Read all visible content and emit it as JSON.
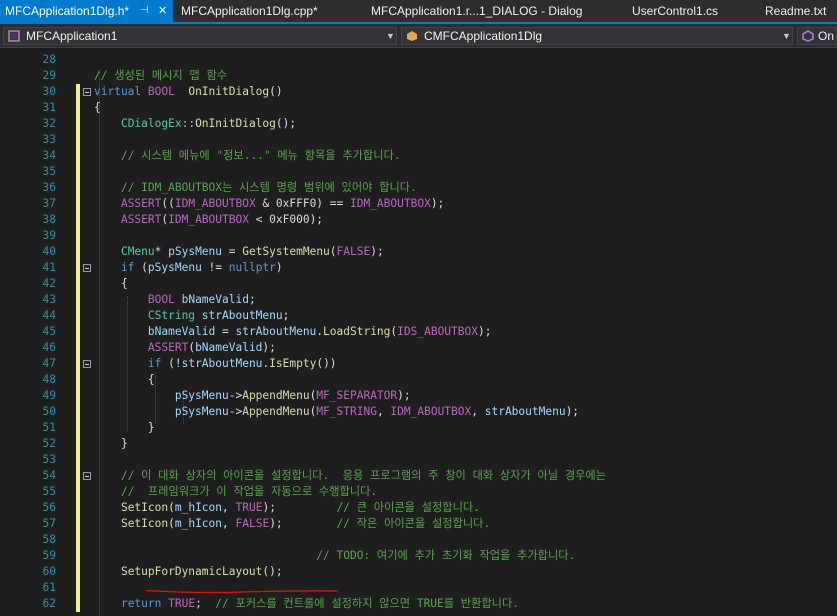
{
  "tabs": [
    {
      "label": "MFCApplication1Dlg.h*",
      "active": true
    },
    {
      "label": "MFCApplication1Dlg.cpp*"
    },
    {
      "label": "MFCApplication1.r...1_DIALOG - Dialog"
    },
    {
      "label": "UserControl1.cs"
    },
    {
      "label": "Readme.txt"
    }
  ],
  "tab_icons": {
    "pin": "pin-icon",
    "close": "close-icon"
  },
  "nav": {
    "project": "MFCApplication1",
    "class": "CMFCApplication1Dlg",
    "member": "On"
  },
  "colors": {
    "accent": "#007acc",
    "line_number": "#2b91af",
    "keyword": "#569cd6",
    "comment": "#57a64a",
    "change_bar": "#eff28e"
  },
  "lines": [
    {
      "n": "28",
      "t": []
    },
    {
      "n": "29",
      "t": [
        [
          "cm",
          "// 생성된 메시지 맵 함수"
        ]
      ]
    },
    {
      "n": "30",
      "t": [
        [
          "kw",
          "virtual "
        ],
        [
          "mac",
          "BOOL"
        ],
        [
          "",
          "  "
        ],
        [
          "fn",
          "OnInitDialog"
        ],
        [
          "",
          "()"
        ]
      ],
      "fold": true
    },
    {
      "n": "31",
      "t": [
        [
          "",
          "{"
        ]
      ]
    },
    {
      "n": "32",
      "t": [
        [
          "",
          "    "
        ],
        [
          "ty",
          "CDialogEx"
        ],
        [
          "op",
          "::"
        ],
        [
          "fn",
          "OnInitDialog"
        ],
        [
          "",
          "();"
        ]
      ]
    },
    {
      "n": "33",
      "t": []
    },
    {
      "n": "34",
      "t": [
        [
          "",
          "    "
        ],
        [
          "cm",
          "// 시스템 메뉴에 \"정보...\" 메뉴 항목을 추가합니다."
        ]
      ]
    },
    {
      "n": "35",
      "t": []
    },
    {
      "n": "36",
      "t": [
        [
          "",
          "    "
        ],
        [
          "cm",
          "// IDM_ABOUTBOX는 시스템 명령 범위에 있어야 합니다."
        ]
      ]
    },
    {
      "n": "37",
      "t": [
        [
          "",
          "    "
        ],
        [
          "mac",
          "ASSERT"
        ],
        [
          "",
          "(("
        ],
        [
          "mac",
          "IDM_ABOUTBOX"
        ],
        [
          "",
          " & 0xFFF0) == "
        ],
        [
          "mac",
          "IDM_ABOUTBOX"
        ],
        [
          "",
          ");"
        ]
      ]
    },
    {
      "n": "38",
      "t": [
        [
          "",
          "    "
        ],
        [
          "mac",
          "ASSERT"
        ],
        [
          "",
          "("
        ],
        [
          "mac",
          "IDM_ABOUTBOX"
        ],
        [
          "",
          " < 0xF000);"
        ]
      ]
    },
    {
      "n": "39",
      "t": []
    },
    {
      "n": "40",
      "t": [
        [
          "",
          "    "
        ],
        [
          "ty",
          "CMenu"
        ],
        [
          "",
          "* "
        ],
        [
          "id",
          "pSysMenu"
        ],
        [
          "",
          " = "
        ],
        [
          "fn",
          "GetSystemMenu"
        ],
        [
          "",
          "("
        ],
        [
          "mac",
          "FALSE"
        ],
        [
          "",
          ");"
        ]
      ]
    },
    {
      "n": "41",
      "t": [
        [
          "",
          "    "
        ],
        [
          "kw",
          "if"
        ],
        [
          "",
          " ("
        ],
        [
          "id",
          "pSysMenu"
        ],
        [
          "",
          " != "
        ],
        [
          "kw",
          "nullptr"
        ],
        [
          "",
          ")"
        ]
      ],
      "fold": true
    },
    {
      "n": "42",
      "t": [
        [
          "",
          "    {"
        ]
      ]
    },
    {
      "n": "43",
      "t": [
        [
          "",
          "        "
        ],
        [
          "mac",
          "BOOL"
        ],
        [
          "",
          " "
        ],
        [
          "id",
          "bNameValid"
        ],
        [
          "",
          ";"
        ]
      ]
    },
    {
      "n": "44",
      "t": [
        [
          "",
          "        "
        ],
        [
          "ty",
          "CString"
        ],
        [
          "",
          " "
        ],
        [
          "id",
          "strAboutMenu"
        ],
        [
          "",
          ";"
        ]
      ]
    },
    {
      "n": "45",
      "t": [
        [
          "",
          "        "
        ],
        [
          "id",
          "bNameValid"
        ],
        [
          "",
          " = "
        ],
        [
          "id",
          "strAboutMenu"
        ],
        [
          "",
          "."
        ],
        [
          "fn",
          "LoadString"
        ],
        [
          "",
          "("
        ],
        [
          "mac",
          "IDS_ABOUTBOX"
        ],
        [
          "",
          ");"
        ]
      ]
    },
    {
      "n": "46",
      "t": [
        [
          "",
          "        "
        ],
        [
          "mac",
          "ASSERT"
        ],
        [
          "",
          "("
        ],
        [
          "id",
          "bNameValid"
        ],
        [
          "",
          ");"
        ]
      ]
    },
    {
      "n": "47",
      "t": [
        [
          "",
          "        "
        ],
        [
          "kw",
          "if"
        ],
        [
          "",
          " (!"
        ],
        [
          "id",
          "strAboutMenu"
        ],
        [
          "",
          "."
        ],
        [
          "fn",
          "IsEmpty"
        ],
        [
          "",
          "())"
        ]
      ],
      "fold": true
    },
    {
      "n": "48",
      "t": [
        [
          "",
          "        {"
        ]
      ]
    },
    {
      "n": "49",
      "t": [
        [
          "",
          "            "
        ],
        [
          "id",
          "pSysMenu"
        ],
        [
          "",
          "->"
        ],
        [
          "fn",
          "AppendMenu"
        ],
        [
          "",
          "("
        ],
        [
          "mac",
          "MF_SEPARATOR"
        ],
        [
          "",
          ");"
        ]
      ]
    },
    {
      "n": "50",
      "t": [
        [
          "",
          "            "
        ],
        [
          "id",
          "pSysMenu"
        ],
        [
          "",
          "->"
        ],
        [
          "fn",
          "AppendMenu"
        ],
        [
          "",
          "("
        ],
        [
          "mac",
          "MF_STRING"
        ],
        [
          "",
          ", "
        ],
        [
          "mac",
          "IDM_ABOUTBOX"
        ],
        [
          "",
          ", "
        ],
        [
          "id",
          "strAboutMenu"
        ],
        [
          "",
          ");"
        ]
      ]
    },
    {
      "n": "51",
      "t": [
        [
          "",
          "        }"
        ]
      ]
    },
    {
      "n": "52",
      "t": [
        [
          "",
          "    }"
        ]
      ]
    },
    {
      "n": "53",
      "t": []
    },
    {
      "n": "54",
      "t": [
        [
          "",
          "    "
        ],
        [
          "cm",
          "// 이 대화 상자의 아이콘을 설정합니다.  응용 프로그램의 주 창이 대화 상자가 아닐 경우에는"
        ]
      ],
      "fold": true
    },
    {
      "n": "55",
      "t": [
        [
          "",
          "    "
        ],
        [
          "cm",
          "//  프레임워크가 이 작업을 자동으로 수행합니다."
        ]
      ]
    },
    {
      "n": "56",
      "t": [
        [
          "",
          "    "
        ],
        [
          "fn",
          "SetIcon"
        ],
        [
          "",
          "("
        ],
        [
          "id",
          "m_hIcon"
        ],
        [
          "",
          ", "
        ],
        [
          "mac",
          "TRUE"
        ],
        [
          "",
          ");         "
        ],
        [
          "cm",
          "// 큰 아이콘을 설정합니다."
        ]
      ]
    },
    {
      "n": "57",
      "t": [
        [
          "",
          "    "
        ],
        [
          "fn",
          "SetIcon"
        ],
        [
          "",
          "("
        ],
        [
          "id",
          "m_hIcon"
        ],
        [
          "",
          ", "
        ],
        [
          "mac",
          "FALSE"
        ],
        [
          "",
          ");        "
        ],
        [
          "cm",
          "// 작은 아이콘을 설정합니다."
        ]
      ]
    },
    {
      "n": "58",
      "t": []
    },
    {
      "n": "59",
      "t": [
        [
          "",
          "                                 "
        ],
        [
          "cm",
          "// TODO: 여기에 추가 초기화 작업을 추가합니다."
        ]
      ]
    },
    {
      "n": "60",
      "t": [
        [
          "",
          "    "
        ],
        [
          "fn",
          "SetupForDynamicLayout"
        ],
        [
          "",
          "();"
        ]
      ]
    },
    {
      "n": "61",
      "t": []
    },
    {
      "n": "62",
      "t": [
        [
          "",
          "    "
        ],
        [
          "kw",
          "return"
        ],
        [
          "",
          " "
        ],
        [
          "mac",
          "TRUE"
        ],
        [
          "",
          ";  "
        ],
        [
          "cm",
          "// 포커스를 컨트롤에 설정하지 않으면 TRUE를 반환합니다."
        ]
      ]
    }
  ]
}
